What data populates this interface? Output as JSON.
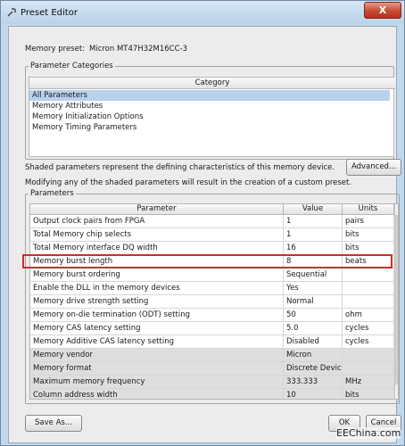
{
  "window": {
    "title": "Preset Editor",
    "close_label": "X"
  },
  "memory_preset": {
    "label": "Memory preset:",
    "value": "Micron MT47H32M16CC-3"
  },
  "categories": {
    "group_title": "Parameter Categories",
    "column_header": "Category",
    "items": [
      {
        "label": "All Parameters",
        "selected": true
      },
      {
        "label": "Memory Attributes",
        "selected": false
      },
      {
        "label": "Memory Initialization Options",
        "selected": false
      },
      {
        "label": "Memory Timing Parameters",
        "selected": false
      }
    ]
  },
  "info": {
    "line1": "Shaded parameters represent the defining characteristics of this memory device.",
    "line2": "Modifying any of the shaded parameters will result in the creation of a custom preset.",
    "advanced_label": "Advanced..."
  },
  "parameters": {
    "group_title": "Parameters",
    "headers": [
      "Parameter",
      "Value",
      "Units"
    ],
    "rows": [
      {
        "name": "Output clock pairs from FPGA",
        "value": "1",
        "units": "pairs",
        "shaded": false
      },
      {
        "name": "Total Memory chip selects",
        "value": "1",
        "units": "bits",
        "shaded": false
      },
      {
        "name": "Total Memory interface DQ width",
        "value": "16",
        "units": "bits",
        "shaded": false
      },
      {
        "name": "Memory burst length",
        "value": "8",
        "units": "beats",
        "shaded": false
      },
      {
        "name": "Memory burst ordering",
        "value": "Sequential",
        "units": "",
        "shaded": false
      },
      {
        "name": "Enable the DLL in the memory devices",
        "value": "Yes",
        "units": "",
        "shaded": false
      },
      {
        "name": "Memory drive strength setting",
        "value": "Normal",
        "units": "",
        "shaded": false
      },
      {
        "name": "Memory on-die termination (ODT) setting",
        "value": "50",
        "units": "ohm",
        "shaded": false
      },
      {
        "name": "Memory CAS latency setting",
        "value": "5.0",
        "units": "cycles",
        "shaded": false
      },
      {
        "name": "Memory Additive CAS latency setting",
        "value": "Disabled",
        "units": "cycles",
        "shaded": false
      },
      {
        "name": "Memory vendor",
        "value": "Micron",
        "units": "",
        "shaded": true
      },
      {
        "name": "Memory format",
        "value": "Discrete Device",
        "units": "",
        "shaded": true
      },
      {
        "name": "Maximum memory frequency",
        "value": "333.333",
        "units": "MHz",
        "shaded": true
      },
      {
        "name": "Column address width",
        "value": "10",
        "units": "bits",
        "shaded": true
      }
    ]
  },
  "buttons": {
    "save_as": "Save As...",
    "ok": "OK",
    "cancel": "Cancel"
  },
  "watermark": "EEChina.com",
  "colors": {
    "highlight": "#d42a2a",
    "selection": "#b9d1ea",
    "shaded_row": "#dedede"
  }
}
